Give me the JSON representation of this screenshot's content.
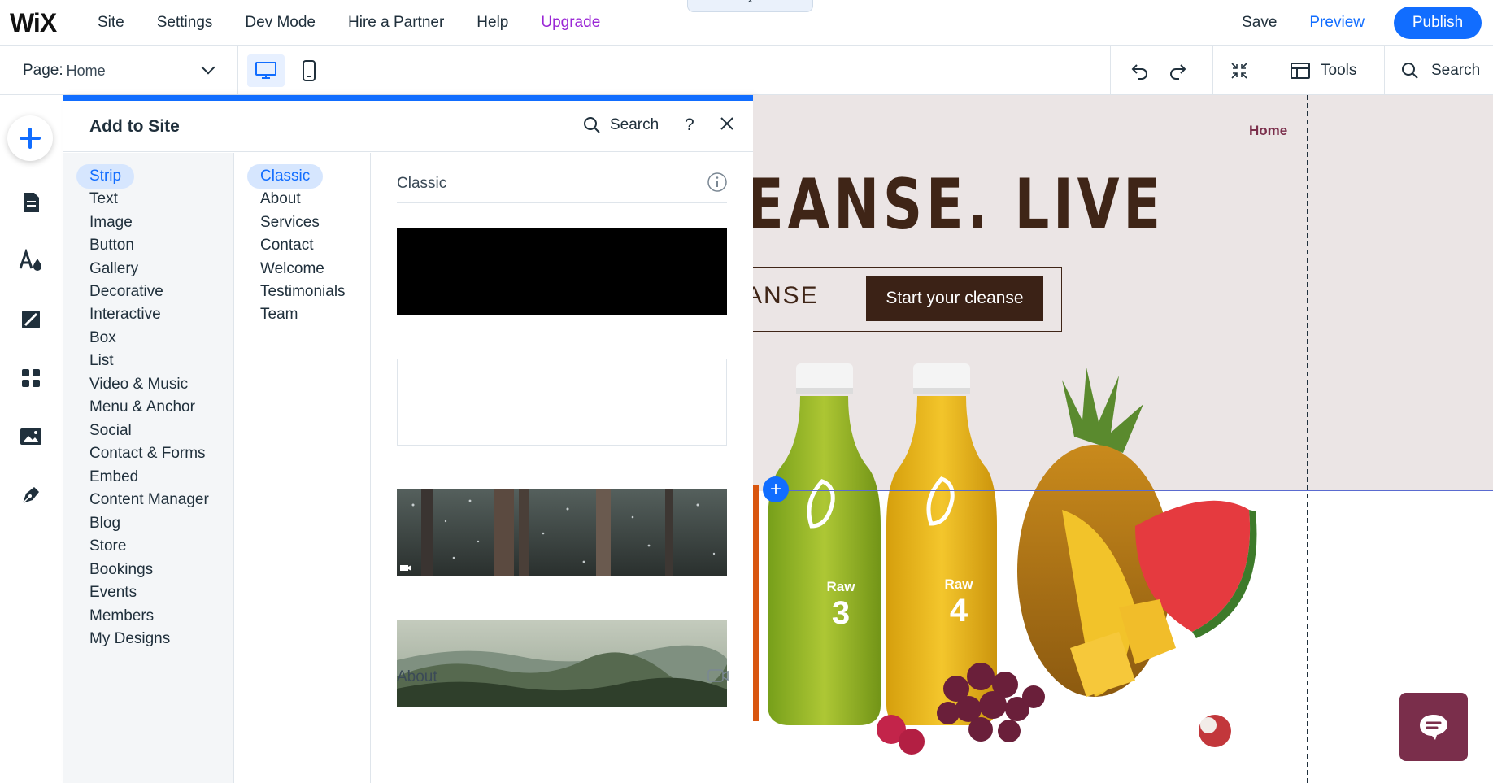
{
  "topbar": {
    "logo": "WiX",
    "menu": [
      "Site",
      "Settings",
      "Dev Mode",
      "Hire a Partner",
      "Help",
      "Upgrade"
    ],
    "notch_icon": "chevron-up",
    "save": "Save",
    "preview": "Preview",
    "publish": "Publish"
  },
  "secondbar": {
    "page_label": "Page:",
    "page_value": "Home",
    "tools": "Tools",
    "search": "Search"
  },
  "panel": {
    "title": "Add to Site",
    "search": "Search",
    "help": "?",
    "categories": [
      "Strip",
      "Text",
      "Image",
      "Button",
      "Gallery",
      "Decorative",
      "Interactive",
      "Box",
      "List",
      "Video & Music",
      "Menu & Anchor",
      "Social",
      "Contact & Forms",
      "Embed",
      "Content Manager",
      "Blog",
      "Store",
      "Bookings",
      "Events",
      "Members",
      "My Designs"
    ],
    "subcategories": [
      "Classic",
      "About",
      "Services",
      "Contact",
      "Welcome",
      "Testimonials",
      "Team"
    ],
    "section_classic": "Classic",
    "section_about": "About"
  },
  "canvas": {
    "nav_home": "Home",
    "hero_text": "EANSE. LIVE",
    "cta_left": "ANSE",
    "cta_button": "Start your cleanse",
    "bottle3_label": "Raw",
    "bottle3_num": "3",
    "bottle4_label": "Raw",
    "bottle4_num": "4"
  },
  "colors": {
    "accent": "#116dff",
    "upgrade": "#9a27d5",
    "brand_brown": "#3f2517",
    "chat": "#7a2e4b"
  }
}
